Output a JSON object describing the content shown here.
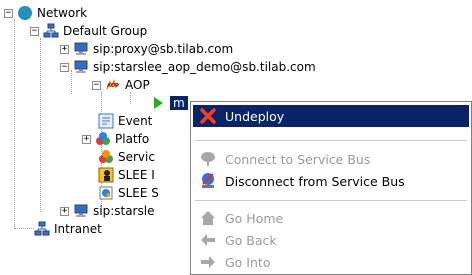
{
  "tree": {
    "network": "Network",
    "default_group": "Default Group",
    "proxy": "sip:proxy@sb.tilab.com",
    "starslee": "sip:starslee_aop_demo@sb.tilab.com",
    "aop": "AOP",
    "aop_badge": "AOP",
    "selected_partial": "m",
    "event": "Event",
    "platform": "Platfo",
    "service": "Servic",
    "slee1": "SLEE I",
    "slee2": "SLEE S",
    "starsle": "sip:starsle",
    "intranet": "Intranet"
  },
  "menu": {
    "undeploy": "Undeploy",
    "connect": "Connect to Service Bus",
    "disconnect": "Disconnect from Service Bus",
    "home": "Go Home",
    "back": "Go Back",
    "into": "Go Into"
  },
  "icons": {
    "network": "globe-icon",
    "group": "network-group-icon",
    "host": "computer-icon",
    "aop": "aop-icon",
    "play": "play-icon",
    "event": "event-icon",
    "platform": "platform-icon",
    "service": "service-icon",
    "slee1": "slee-person-icon",
    "slee2": "slee-service-icon",
    "undeploy": "red-x-icon",
    "connect": "connect-bus-icon",
    "disconnect": "disconnect-bus-icon",
    "home": "home-icon",
    "back": "back-arrow-icon",
    "into": "forward-arrow-icon"
  },
  "colors": {
    "selection": "#0a246a",
    "disabled_text": "#9a9a9a",
    "tree_line": "#a0a0a0"
  }
}
